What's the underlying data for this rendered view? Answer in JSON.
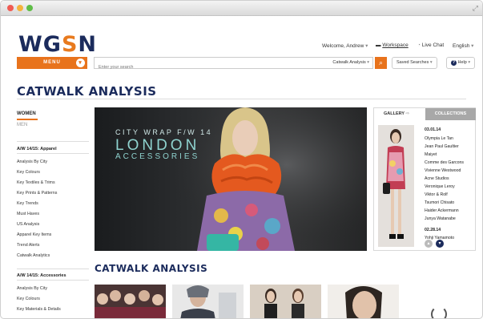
{
  "header": {
    "logo_left": "WG",
    "logo_mid": "S",
    "logo_right": "N",
    "welcome": "Welcome, Andrew",
    "workspace": "Workspace",
    "live_chat": "Live Chat",
    "language": "English"
  },
  "toolbar": {
    "menu_label": "MENU",
    "search_placeholder": "Enter your search",
    "search_scope": "Catwalk Analysis",
    "saved_searches": "Saved Searches",
    "help": "Help"
  },
  "page_title": "CATWALK ANALYSIS",
  "sidebar": {
    "gender_active": "WOMEN",
    "gender_other": "MEN",
    "section1_title": "A/W 14/15: Apparel",
    "section1_items": [
      "Analysis By City",
      "Key Colours",
      "Key Textiles & Trims",
      "Key Prints & Patterns",
      "Key Trends",
      "Must Haves",
      "US Analysis",
      "Apparel Key Items",
      "Trend Alerts",
      "Catwalk Analytics"
    ],
    "section2_title": "A/W 14/15: Accessories",
    "section2_items": [
      "Analysis By City",
      "Key Colours",
      "Key Materials & Details"
    ]
  },
  "hero": {
    "line1": "CITY WRAP F/W 14",
    "line2": "LONDON",
    "line3": "ACCESSORIES"
  },
  "gallery": {
    "tab_gallery": "GALLERY",
    "tab_collections": "COLLECTIONS",
    "date1": "03.01.14",
    "designers1": [
      "Olympia Le Tan",
      "Jean Paul Gaultier",
      "Maiyet",
      "Comme des Garcons",
      "Vivienne Westwood",
      "Acne Studios",
      "Veronique Leroy",
      "Viktor & Rolf",
      "Tsumori Chisato",
      "Haider Ackermann",
      "Junya Watanabe"
    ],
    "date2": "02.28.14",
    "designers2": [
      "Yohji Yamamoto"
    ]
  },
  "section_title": "CATWALK ANALYSIS",
  "colors": {
    "accent": "#e8731c",
    "brand": "#1b2b5c",
    "hero_text": "#8fd3cf"
  }
}
